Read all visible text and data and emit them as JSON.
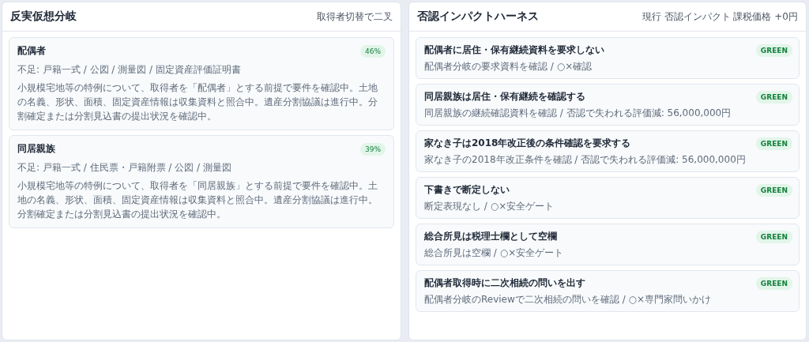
{
  "left_panel": {
    "title": "反実仮想分岐",
    "note": "取得者切替で二叉",
    "branches": [
      {
        "name": "配偶者",
        "percent": "46%",
        "missing": "不足: 戸籍一式 / 公図 / 測量図 / 固定資産評価証明書",
        "description": "小規模宅地等の特例について、取得者を「配偶者」とする前提で要件を確認中。土地の名義、形状、面積、固定資産情報は収集資料と照合中。遺産分割協議は進行中。分割確定または分割見込書の提出状況を確認中。"
      },
      {
        "name": "同居親族",
        "percent": "39%",
        "missing": "不足: 戸籍一式 / 住民票・戸籍附票 / 公図 / 測量図",
        "description": "小規模宅地等の特例について、取得者を「同居親族」とする前提で要件を確認中。土地の名義、形状、面積、固定資産情報は収集資料と照合中。遺産分割協議は進行中。分割確定または分割見込書の提出状況を確認中。"
      }
    ]
  },
  "right_panel": {
    "title": "否認インパクトハーネス",
    "note": "現行 否認インパクト 課税価格 +0円",
    "checks": [
      {
        "title": "配偶者に居住・保有継続資料を要求しない",
        "status": "GREEN",
        "detail": "配偶者分岐の要求資料を確認 / ○×確認"
      },
      {
        "title": "同居親族は居住・保有継続を確認する",
        "status": "GREEN",
        "detail": "同居親族の継続確認資料を確認 / 否認で失われる評価減: 56,000,000円"
      },
      {
        "title": "家なき子は2018年改正後の条件確認を要求する",
        "status": "GREEN",
        "detail": "家なき子の2018年改正条件を確認 / 否認で失われる評価減: 56,000,000円"
      },
      {
        "title": "下書きで断定しない",
        "status": "GREEN",
        "detail": "断定表現なし / ○×安全ゲート"
      },
      {
        "title": "総合所見は税理士欄として空欄",
        "status": "GREEN",
        "detail": "総合所見は空欄 / ○×安全ゲート"
      },
      {
        "title": "配偶者取得時に二次相続の問いを出す",
        "status": "GREEN",
        "detail": "配偶者分岐のReviewで二次相続の問いを確認 / ○×専門家問いかけ"
      }
    ]
  }
}
